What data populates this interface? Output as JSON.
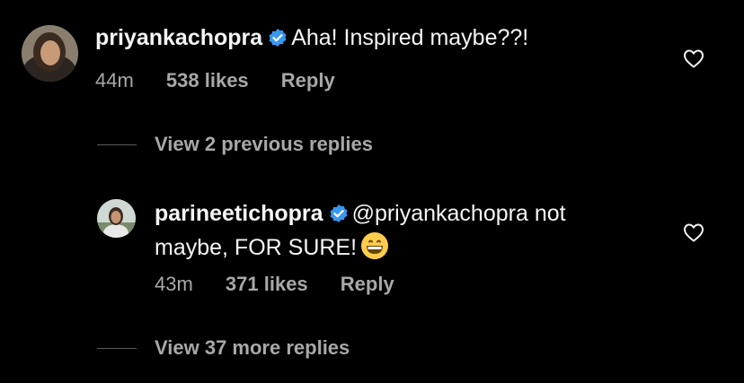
{
  "comments": [
    {
      "username": "priyankachopra",
      "text": "Aha! Inspired maybe??!",
      "time": "44m",
      "likes": "538 likes",
      "reply_label": "Reply"
    },
    {
      "username": "parineetichopra",
      "text_line1": "@priyankachopra not",
      "text_line2": "maybe, FOR SURE!",
      "time": "43m",
      "likes": "371 likes",
      "reply_label": "Reply"
    }
  ],
  "view_previous": "View 2 previous replies",
  "view_more": "View 37 more replies",
  "colors": {
    "background": "#000000",
    "verified": "#3897f0",
    "muted": "#a8a8a8"
  },
  "icons": [
    "verified-badge-icon",
    "heart-icon",
    "grinning-emoji-icon"
  ]
}
